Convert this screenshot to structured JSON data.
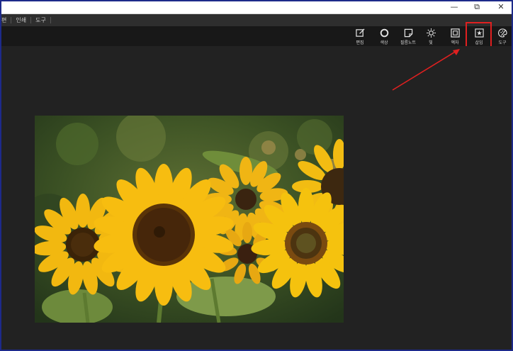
{
  "window": {
    "minimize_glyph": "—",
    "restore_glyph": "⧉",
    "close_glyph": "✕"
  },
  "menubar": {
    "items": [
      "편",
      "인쇄",
      "도구"
    ]
  },
  "toolbar": {
    "items": [
      {
        "label": "편집",
        "icon": "edit-icon"
      },
      {
        "label": "색상",
        "icon": "circle-icon"
      },
      {
        "label": "필름노트",
        "icon": "note-icon"
      },
      {
        "label": "빛",
        "icon": "sun-icon"
      },
      {
        "label": "액자",
        "icon": "frame-icon"
      },
      {
        "label": "삽입",
        "icon": "star-insert-icon"
      },
      {
        "label": "도구",
        "icon": "palette-icon"
      }
    ],
    "highlighted_item": "삽입"
  },
  "colors": {
    "highlight": "#e02020",
    "background": "#1f1f1f",
    "toolbar": "#181818"
  }
}
